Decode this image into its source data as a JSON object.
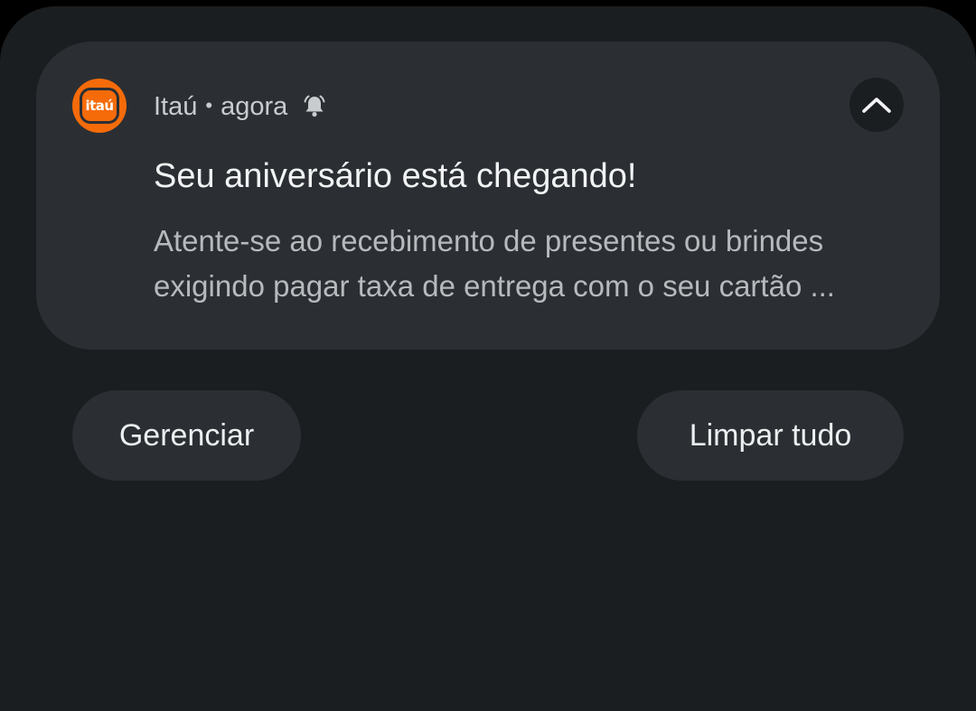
{
  "notification": {
    "app_name": "Itaú",
    "separator": "•",
    "time": "agora",
    "icon_label": "itaú",
    "title": "Seu aniversário está chegando!",
    "body_line1": "Atente-se ao recebimento de presentes ou brindes",
    "body_line2": "exigindo pagar taxa de entrega com o seu cartão ...",
    "icons": [
      "itau-logo-icon",
      "bell-ringing-icon",
      "chevron-up-icon"
    ]
  },
  "actions": {
    "manage_label": "Gerenciar",
    "clear_all_label": "Limpar tudo"
  },
  "colors": {
    "shade_background": "#1b1e21",
    "card_background": "#2b2f33",
    "brand_orange": "#f56b0a"
  }
}
